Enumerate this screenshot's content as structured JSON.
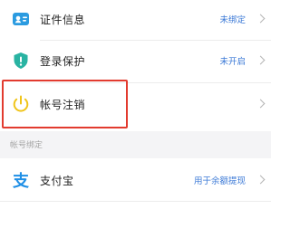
{
  "rows": {
    "cert": {
      "label": "证件信息",
      "value": "未绑定",
      "icon": "id-card-icon",
      "icon_color": "#2b9be0"
    },
    "login": {
      "label": "登录保护",
      "value": "未开启",
      "icon": "shield-exclamation-icon",
      "icon_color": "#29b3a2"
    },
    "cancel": {
      "label": "帐号注销",
      "icon": "power-icon",
      "icon_color": "#f0c419"
    }
  },
  "section": {
    "title": "帐号绑定"
  },
  "bindings": {
    "alipay": {
      "label": "支付宝",
      "value": "用于余额提现",
      "icon": "alipay-icon",
      "icon_color": "#1f8fe6"
    }
  },
  "colors": {
    "value_text": "#3a78d6",
    "highlight": "#e23b2f",
    "section_bg": "#f4f4f6"
  }
}
